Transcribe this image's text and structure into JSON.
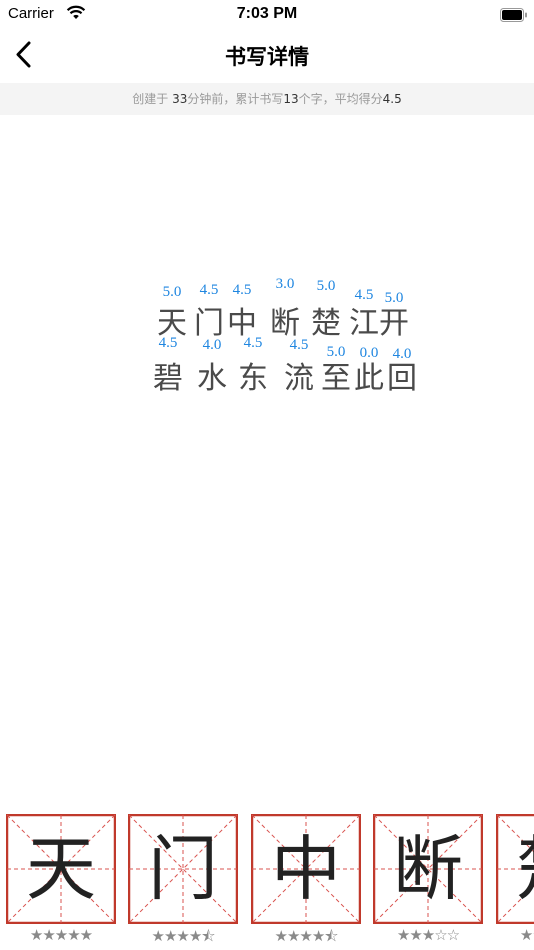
{
  "status_bar": {
    "carrier": "Carrier",
    "time": "7:03 PM"
  },
  "nav": {
    "title": "书写详情"
  },
  "summary": {
    "prefix": "创建于 ",
    "minutes": "33",
    "mid1": "分钟前，累计书写",
    "count": "13",
    "mid2": "个字，平均得分",
    "avg": "4.5"
  },
  "poem": {
    "rows": [
      {
        "chars": [
          "天",
          "门",
          "中",
          "断",
          "楚",
          "江",
          "开"
        ],
        "scores": [
          "5.0",
          "4.5",
          "4.5",
          "3.0",
          "5.0",
          "4.5",
          "5.0"
        ]
      },
      {
        "chars": [
          "碧",
          "水",
          "东",
          "流",
          "至",
          "此",
          "回"
        ],
        "scores": [
          "4.5",
          "4.0",
          "4.5",
          "4.5",
          "5.0",
          "0.0",
          "4.0"
        ]
      }
    ]
  },
  "strip": {
    "cards": [
      {
        "char": "天",
        "stars": "★★★★★"
      },
      {
        "char": "门",
        "stars": "★★★★⯪"
      },
      {
        "char": "中",
        "stars": "★★★★⯪"
      },
      {
        "char": "断",
        "stars": "★★★☆☆"
      },
      {
        "char": "楚",
        "stars": "★★★★★"
      }
    ]
  },
  "colors": {
    "score": "#1f86e0",
    "grid_border": "#c0392b",
    "grid_guides": "#d9534f",
    "summary_bg": "#f4f4f4"
  }
}
